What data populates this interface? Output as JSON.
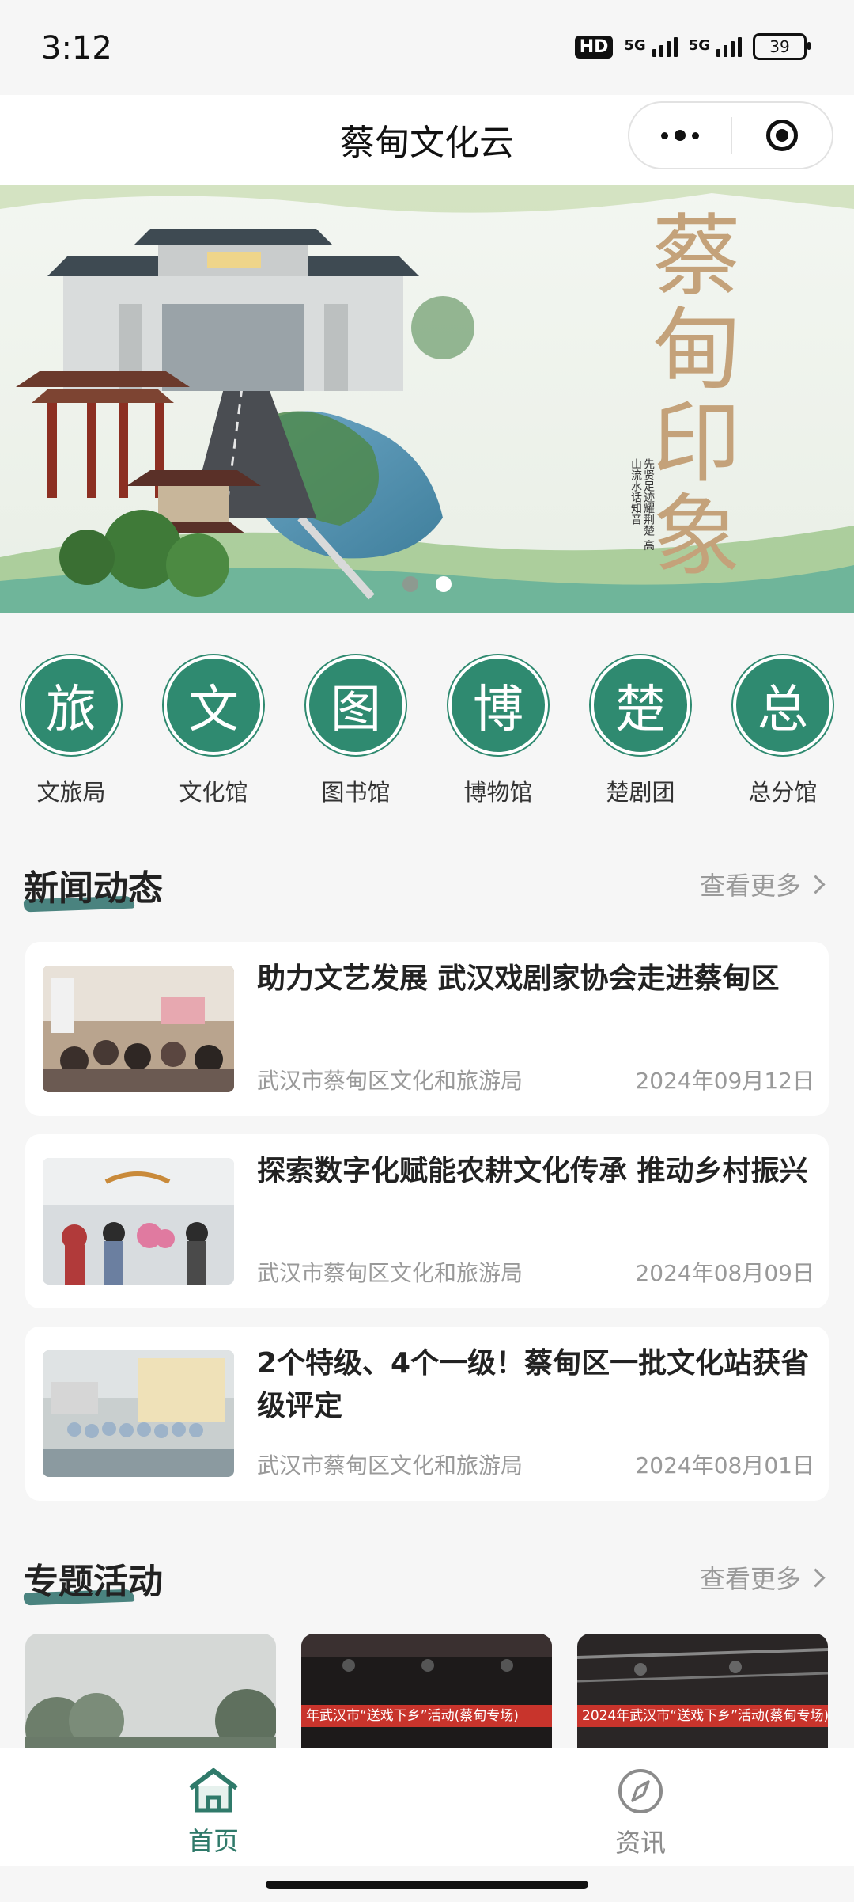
{
  "status_bar": {
    "time": "3:12",
    "hd_label": "HD",
    "network_1": "5G",
    "network_2": "5G",
    "battery": "39"
  },
  "navbar": {
    "title": "蔡甸文化云"
  },
  "banner": {
    "headline": "蔡甸印象",
    "caption": "先贤足迹耀荆楚 高山流水话知音",
    "slide_count": 2,
    "active_slide": 2
  },
  "categories": [
    {
      "glyph": "旅",
      "label": "文旅局"
    },
    {
      "glyph": "文",
      "label": "文化馆"
    },
    {
      "glyph": "图",
      "label": "图书馆"
    },
    {
      "glyph": "博",
      "label": "博物馆"
    },
    {
      "glyph": "楚",
      "label": "楚剧团"
    },
    {
      "glyph": "总",
      "label": "总分馆"
    }
  ],
  "news_section": {
    "title": "新闻动态",
    "more": "查看更多",
    "items": [
      {
        "title": "助力文艺发展 武汉戏剧家协会走进蔡甸区",
        "source": "武汉市蔡甸区文化和旅游局",
        "date": "2024年09月12日"
      },
      {
        "title": "探索数字化赋能农耕文化传承 推动乡村振兴",
        "source": "武汉市蔡甸区文化和旅游局",
        "date": "2024年08月09日"
      },
      {
        "title": "2个特级、4个一级！蔡甸区一批文化站获省级评定",
        "source": "武汉市蔡甸区文化和旅游局",
        "date": "2024年08月01日"
      }
    ]
  },
  "activity_section": {
    "title": "专题活动",
    "more": "查看更多",
    "cards": [
      {
        "banner_text": ""
      },
      {
        "banner_text": "年武汉市“送戏下乡”活动(蔡甸专场)"
      },
      {
        "banner_text": "2024年武汉市“送戏下乡”活动(蔡甸专场)"
      }
    ]
  },
  "tabbar": {
    "items": [
      {
        "label": "首页",
        "icon": "home-icon",
        "active": true
      },
      {
        "label": "资讯",
        "icon": "compass-icon",
        "active": false
      }
    ],
    "active_color": "#2f7a6a"
  }
}
